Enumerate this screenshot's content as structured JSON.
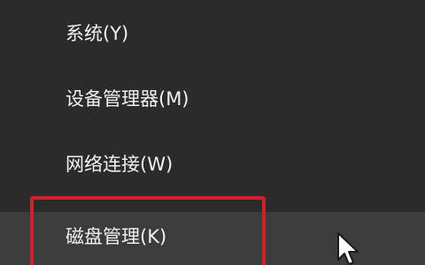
{
  "context_menu": {
    "items": [
      {
        "label": "系统(Y)"
      },
      {
        "label": "设备管理器(M)"
      },
      {
        "label": "网络连接(W)"
      },
      {
        "label": "磁盘管理(K)"
      }
    ]
  },
  "colors": {
    "background": "#2b2b2b",
    "hover_background": "#3c3c3c",
    "text": "#f2f2f2",
    "highlight_border": "#d0202a"
  },
  "icons": {
    "cursor": "mouse-pointer-icon"
  }
}
